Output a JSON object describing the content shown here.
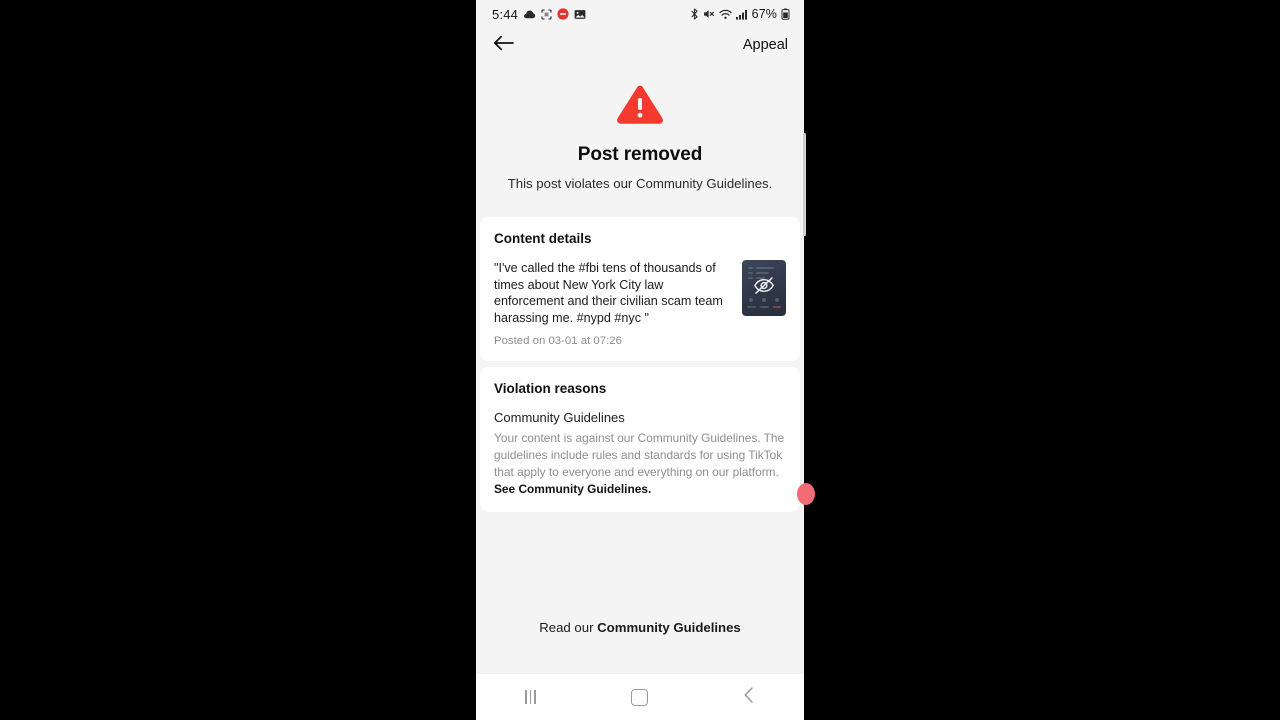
{
  "status_bar": {
    "time": "5:44",
    "left_icons": [
      "cloud-icon",
      "screenshot-icon",
      "notification-badge-icon",
      "photo-icon"
    ],
    "right_icons": [
      "bluetooth-icon",
      "mute-icon",
      "wifi-icon",
      "signal-icon"
    ],
    "battery_percent": "67%",
    "battery_icon": "battery-icon"
  },
  "app_bar": {
    "back_icon": "back-arrow-icon",
    "title": "Appeal"
  },
  "hero": {
    "warning_icon": "warning-triangle-icon",
    "title": "Post removed",
    "subtitle": "This post violates our Community Guidelines."
  },
  "content_details": {
    "heading": "Content details",
    "post_text": "\"I've called the #fbi tens of thousands of times about New York City law enforcement and their civilian scam team harassing me. #nypd #nyc \"",
    "posted_meta": "Posted on 03-01 at 07:26",
    "thumbnail_icon": "eye-off-icon"
  },
  "violation_reasons": {
    "heading": "Violation reasons",
    "reason_title": "Community Guidelines",
    "reason_body_prefix": "Your content is against our Community Guidelines. The guidelines include rules and standards for using TikTok that apply to everyone and everything on our platform. ",
    "reason_link": "See Community Guidelines."
  },
  "footer": {
    "prefix": "Read our ",
    "link": "Community Guidelines"
  },
  "nav_bar": {
    "recents_icon": "recents-icon",
    "home_icon": "home-icon",
    "back_icon": "nav-back-icon"
  },
  "colors": {
    "page_background": "#f4f4f4",
    "card_background": "#ffffff",
    "warning_red": "#f5392e",
    "muted_text": "#8d8d8d",
    "edge_dot": "#f36b74"
  }
}
